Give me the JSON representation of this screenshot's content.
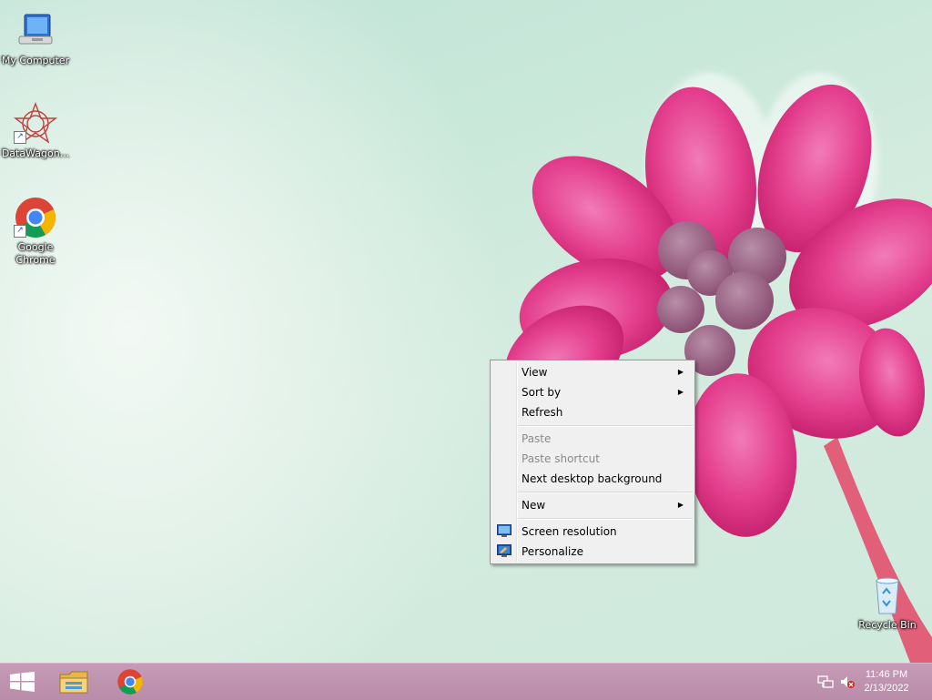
{
  "desktop": {
    "icons": [
      {
        "label": "My Computer"
      },
      {
        "label": "DataWagon..."
      },
      {
        "label": "Google Chrome"
      },
      {
        "label": "Recycle Bin"
      }
    ]
  },
  "context_menu": {
    "items": [
      {
        "label": "View",
        "submenu": true,
        "enabled": true
      },
      {
        "label": "Sort by",
        "submenu": true,
        "enabled": true
      },
      {
        "label": "Refresh",
        "enabled": true
      },
      {
        "label": "Paste",
        "enabled": false
      },
      {
        "label": "Paste shortcut",
        "enabled": false
      },
      {
        "label": "Next desktop background",
        "enabled": true
      },
      {
        "label": "New",
        "submenu": true,
        "enabled": true
      },
      {
        "label": "Screen resolution",
        "enabled": true,
        "icon": "screen-resolution-icon"
      },
      {
        "label": "Personalize",
        "enabled": true,
        "icon": "personalize-icon"
      }
    ]
  },
  "taskbar": {
    "start_icon": "windows-logo-icon",
    "pinned": [
      "file-explorer-icon",
      "chrome-icon"
    ],
    "tray": {
      "time": "11:46 PM",
      "date": "2/13/2022",
      "icons": [
        "network-icon",
        "volume-muted-icon"
      ]
    }
  },
  "colors": {
    "taskbar": "#b98ca9",
    "menu_bg": "#f0f0f0",
    "flower": "#e4408f"
  }
}
